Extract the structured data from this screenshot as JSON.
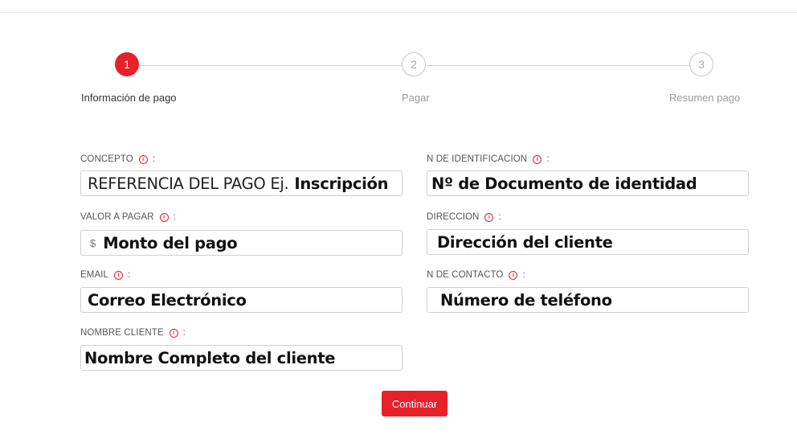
{
  "stepper": {
    "steps": [
      {
        "number": "1",
        "label": "Información de pago",
        "state": "active"
      },
      {
        "number": "2",
        "label": "Pagar",
        "state": "inactive"
      },
      {
        "number": "3",
        "label": "Resumen pago",
        "state": "inactive"
      }
    ]
  },
  "form": {
    "concepto": {
      "label": "CONCEPTO",
      "placeholder_prefix": "REFERENCIA DEL PAGO Ej.",
      "placeholder_bold": "Inscripción"
    },
    "id_number": {
      "label": "N DE IDENTIFICACION",
      "placeholder": "Nº de Documento de identidad"
    },
    "valor": {
      "label": "VALOR A PAGAR",
      "currency_symbol": "$",
      "placeholder": "Monto del pago"
    },
    "direccion": {
      "label": "DIRECCION",
      "placeholder": "Dirección del cliente"
    },
    "email": {
      "label": "EMAIL",
      "placeholder": "Correo Electrónico"
    },
    "contacto": {
      "label": "N DE CONTACTO",
      "placeholder": "Número de teléfono"
    },
    "nombre": {
      "label": "NOMBRE CLIENTE",
      "placeholder": "Nombre Completo del cliente"
    },
    "info_icon": "info-icon",
    "colon": ":"
  },
  "actions": {
    "continue_label": "Continuar"
  },
  "colors": {
    "accent": "#e8202a",
    "inactive": "#a9a9a9",
    "border": "#cfcfcf"
  }
}
